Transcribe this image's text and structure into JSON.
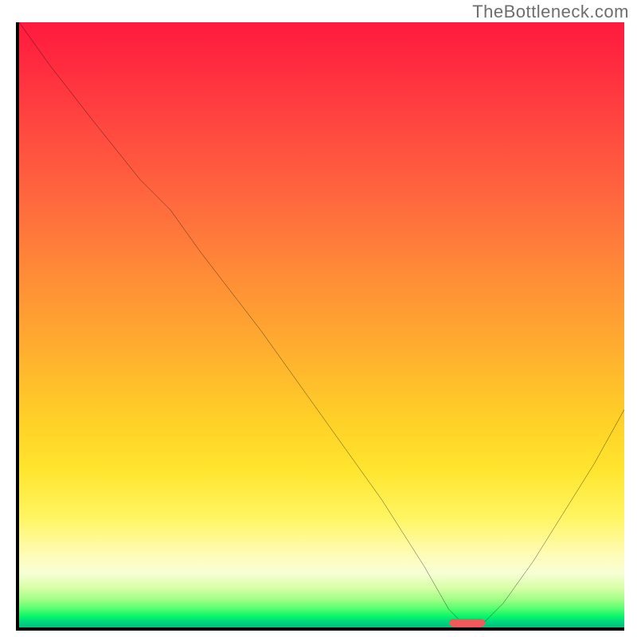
{
  "watermark": "TheBottleneck.com",
  "chart_data": {
    "type": "line",
    "title": "",
    "xlabel": "",
    "ylabel": "",
    "watermark": "TheBottleneck.com",
    "xlim": [
      0,
      100
    ],
    "ylim": [
      0,
      100
    ],
    "background_gradient": {
      "direction": "top-to-bottom",
      "stops": [
        {
          "pct": 0,
          "color": "#ff1a3f"
        },
        {
          "pct": 30,
          "color": "#ff6a3e"
        },
        {
          "pct": 66,
          "color": "#ffd127"
        },
        {
          "pct": 88,
          "color": "#fffcb8"
        },
        {
          "pct": 97,
          "color": "#4dff6f"
        },
        {
          "pct": 100,
          "color": "#02c07f"
        }
      ]
    },
    "curve": {
      "description": "bottleneck cost curve; minimum ~x=73 at y≈1",
      "x": [
        0,
        5,
        12,
        20,
        25,
        30,
        40,
        50,
        60,
        67,
        71,
        73,
        77,
        80,
        85,
        90,
        95,
        100
      ],
      "y": [
        100,
        93,
        84,
        74,
        69,
        62,
        49,
        35,
        21,
        10,
        3,
        1,
        1,
        4,
        11,
        19,
        27,
        36
      ]
    },
    "marker": {
      "x_start": 71,
      "x_end": 77,
      "y": 0.8,
      "color": "#f05a5a"
    }
  }
}
